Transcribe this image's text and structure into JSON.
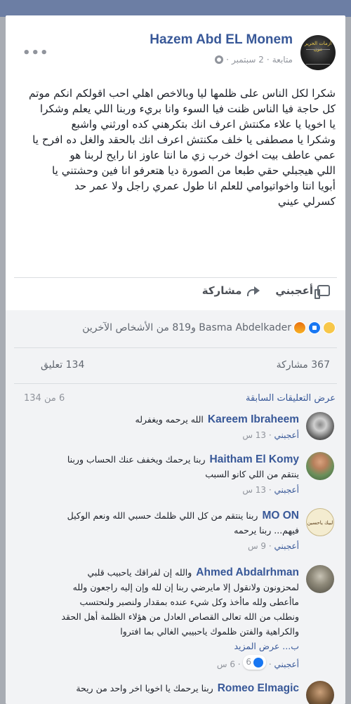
{
  "post": {
    "author": "Hazem Abd EL Monem",
    "date": "2 سبتمبر",
    "follow": "متابعة",
    "avatar_text": "أزمات الحرير مون",
    "lines": [
      "شكرا لكل الناس على ظلمها ليا وبالاخص اهلي احب اقولكم انكم موتم",
      "كل حاجة فيا الناس ظنت فيا السوء وانا بريء وربنا اللي يعلم وشكرا",
      "يا اخويا يا علاء مكنتش اعرف انك بتكرهني كده اورثني واشبع",
      "وشكرا يا مصطفى يا خلف مكنتش اعرف انك بالحقد والغل ده افرح يا",
      "عمي عاطف بيت اخوك خرب زي ما انتا عاوز انا رايح لربنا هو",
      "اللي هيجبلي حقي طبعا من الصورة ديا هتعرفو انا فين وحشتني يا",
      "أبويا انتا واخواتيوامي للعلم انا طول عمري راجل ولا عمر حد",
      "كسرلي عيني"
    ]
  },
  "actions": {
    "like": "أعجبني",
    "share": "مشاركة"
  },
  "reactions": {
    "summary": "Basma Abdelkader و819 من الأشخاص الآخرين",
    "types": [
      "sad",
      "like",
      "angry"
    ]
  },
  "counts": {
    "shares": "367 مشاركة",
    "comments": "134 تعليق"
  },
  "previous": {
    "label": "عرض التعليقات السابقة",
    "page": "6 من 134"
  },
  "comments": [
    {
      "name": "Kareem Ibraheem",
      "lines": [
        "الله يرحمه ويغفرله"
      ],
      "like": "أعجبني",
      "time": "13 س"
    },
    {
      "name": "Haitham El Komy",
      "lines": [
        "ربنا يرحمك ويخفف عنك الحساب وربنا",
        "ينتقم من اللي كانو السبب"
      ],
      "like": "أعجبني",
      "time": "13 س"
    },
    {
      "name": "MO ON",
      "avatar_text": "لبيك ياحسين",
      "lines": [
        "ربنا ينتقم من كل اللي ظلمك حسبي الله ونعم الوكيل",
        "فيهم... ربنا يرحمه"
      ],
      "like": "أعجبني",
      "time": "9 س"
    },
    {
      "name": "Ahmed Abdalrhman",
      "lines": [
        "والله إن لفراقك ياحبيب قلبي",
        "لمحزونون ولانقول إلا مايرضي ربنا إن لله وإن إليه راجعون ولله",
        "ماأعطى ولله ماأخذ وكل شيء عنده بمقدار ولنصبر ولنحتسب",
        "ونطلب من الله تعالى القصاص العادل من هؤلاء الظلمة أهل الحقد",
        "والكراهية والفتن ظلموك ياحبيبي الغالي بما افتروا"
      ],
      "see_more": "ب... عرض المزيد",
      "like": "أعجبني",
      "likes": "6",
      "time": "6 س"
    },
    {
      "name": "Romeo Elmagic",
      "lines": [
        "ربنا يرحمك يا اخويا اخر واحد من ريحة"
      ],
      "like": "",
      "time": ""
    }
  ]
}
